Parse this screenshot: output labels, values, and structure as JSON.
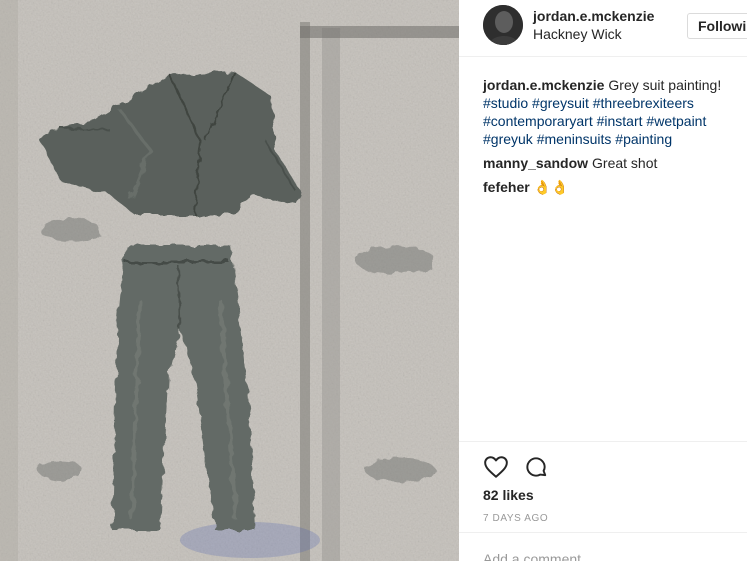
{
  "post": {
    "author": "jordan.e.mckenzie",
    "location": "Hackney Wick",
    "follow_label": "Followin",
    "caption": {
      "user": "jordan.e.mckenzie",
      "text": "Grey suit painting!",
      "hashtags": [
        "#studio",
        "#greysuit",
        "#threebrexiteers",
        "#contemporaryart",
        "#instart",
        "#wetpaint",
        "#greyuk",
        "#meninsuits",
        "#painting"
      ]
    },
    "comments": [
      {
        "user": "manny_sandow",
        "text": "Great shot"
      },
      {
        "user": "fefeher",
        "text": "👌👌"
      }
    ],
    "likes": "82 likes",
    "time": "7 DAYS AGO",
    "add_comment_placeholder": "Add a comment..."
  },
  "icons": {
    "like": "heart-outline-icon",
    "comment": "speech-bubble-icon"
  }
}
